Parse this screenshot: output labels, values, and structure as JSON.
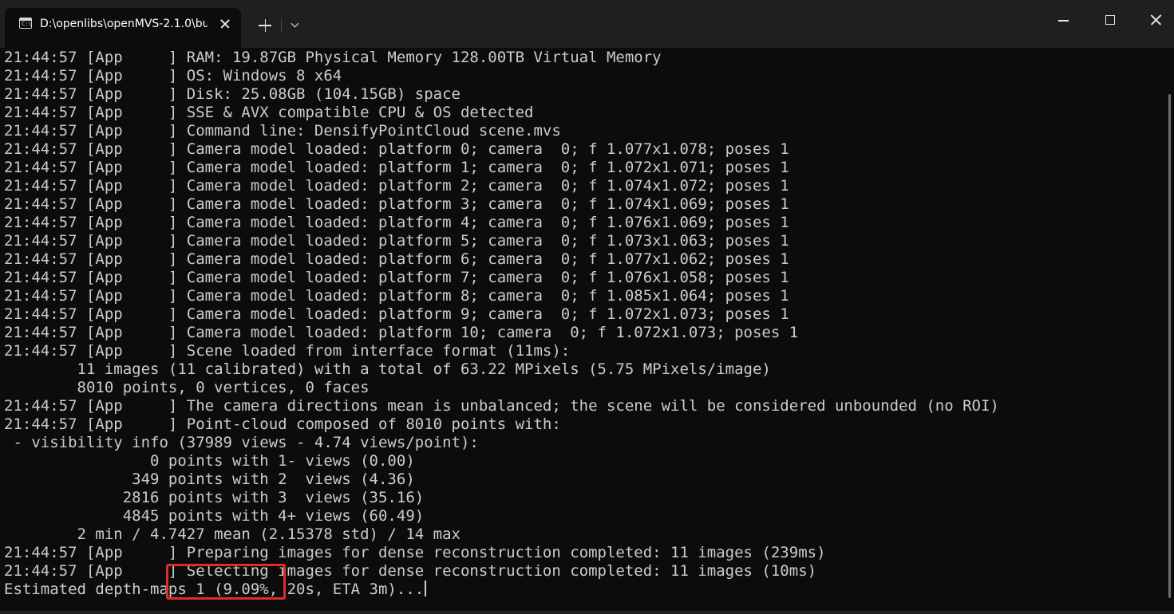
{
  "tab": {
    "title": "D:\\openlibs\\openMVS-2.1.0\\bu",
    "icon": "terminal-icon",
    "icon_glyph": "C:\\"
  },
  "window_controls": {
    "minimize_icon": "minimize-icon",
    "maximize_icon": "maximize-icon",
    "close_icon": "close-icon"
  },
  "colors": {
    "background": "#0c0c0c",
    "text": "#cccccc",
    "titlebar": "#1f1f1f",
    "highlight": "#e12b2b"
  },
  "terminal": {
    "lines": [
      "21:44:57 [App     ] RAM: 19.87GB Physical Memory 128.00TB Virtual Memory",
      "21:44:57 [App     ] OS: Windows 8 x64",
      "21:44:57 [App     ] Disk: 25.08GB (104.15GB) space",
      "21:44:57 [App     ] SSE & AVX compatible CPU & OS detected",
      "21:44:57 [App     ] Command line: DensifyPointCloud scene.mvs",
      "21:44:57 [App     ] Camera model loaded: platform 0; camera  0; f 1.077x1.078; poses 1",
      "21:44:57 [App     ] Camera model loaded: platform 1; camera  0; f 1.072x1.071; poses 1",
      "21:44:57 [App     ] Camera model loaded: platform 2; camera  0; f 1.074x1.072; poses 1",
      "21:44:57 [App     ] Camera model loaded: platform 3; camera  0; f 1.074x1.069; poses 1",
      "21:44:57 [App     ] Camera model loaded: platform 4; camera  0; f 1.076x1.069; poses 1",
      "21:44:57 [App     ] Camera model loaded: platform 5; camera  0; f 1.073x1.063; poses 1",
      "21:44:57 [App     ] Camera model loaded: platform 6; camera  0; f 1.077x1.062; poses 1",
      "21:44:57 [App     ] Camera model loaded: platform 7; camera  0; f 1.076x1.058; poses 1",
      "21:44:57 [App     ] Camera model loaded: platform 8; camera  0; f 1.085x1.064; poses 1",
      "21:44:57 [App     ] Camera model loaded: platform 9; camera  0; f 1.072x1.073; poses 1",
      "21:44:57 [App     ] Camera model loaded: platform 10; camera  0; f 1.072x1.073; poses 1",
      "21:44:57 [App     ] Scene loaded from interface format (11ms):",
      "        11 images (11 calibrated) with a total of 63.22 MPixels (5.75 MPixels/image)",
      "        8010 points, 0 vertices, 0 faces",
      "21:44:57 [App     ] The camera directions mean is unbalanced; the scene will be considered unbounded (no ROI)",
      "21:44:57 [App     ] Point-cloud composed of 8010 points with:",
      " - visibility info (37989 views - 4.74 views/point):",
      "                0 points with 1- views (0.00)",
      "              349 points with 2  views (4.36)",
      "             2816 points with 3  views (35.16)",
      "             4845 points with 4+ views (60.49)",
      "        2 min / 4.7427 mean (2.15378 std) / 14 max",
      "21:44:57 [App     ] Preparing images for dense reconstruction completed: 11 images (239ms)",
      "21:44:57 [App     ] Selecting images for dense reconstruction completed: 11 images (10ms)",
      "Estimated depth-maps 1 (9.09%, 20s, ETA 3m)..."
    ]
  }
}
